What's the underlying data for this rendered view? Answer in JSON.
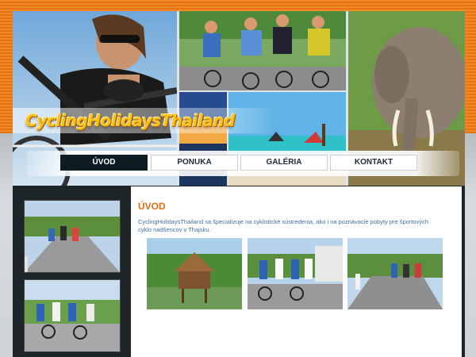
{
  "site": {
    "logo_text": "CyclingHolidaysThailand"
  },
  "nav": {
    "items": [
      {
        "label": "ÚVOD",
        "active": true
      },
      {
        "label": "PONUKA",
        "active": false
      },
      {
        "label": "GALÉRIA",
        "active": false
      },
      {
        "label": "KONTAKT",
        "active": false
      }
    ]
  },
  "main": {
    "heading": "ÚVOD",
    "intro": "CyclingHolidaysThailand sa špecializuje na cyklistické sústredenia, ako i na poznávacie pobyty pre športových cyklo nadšencov v Thajsku."
  },
  "colors": {
    "brand_orange": "#f08020",
    "heading_orange": "#e46d12",
    "nav_active": "#0e1b22",
    "text_blue": "#3f6f9e"
  }
}
